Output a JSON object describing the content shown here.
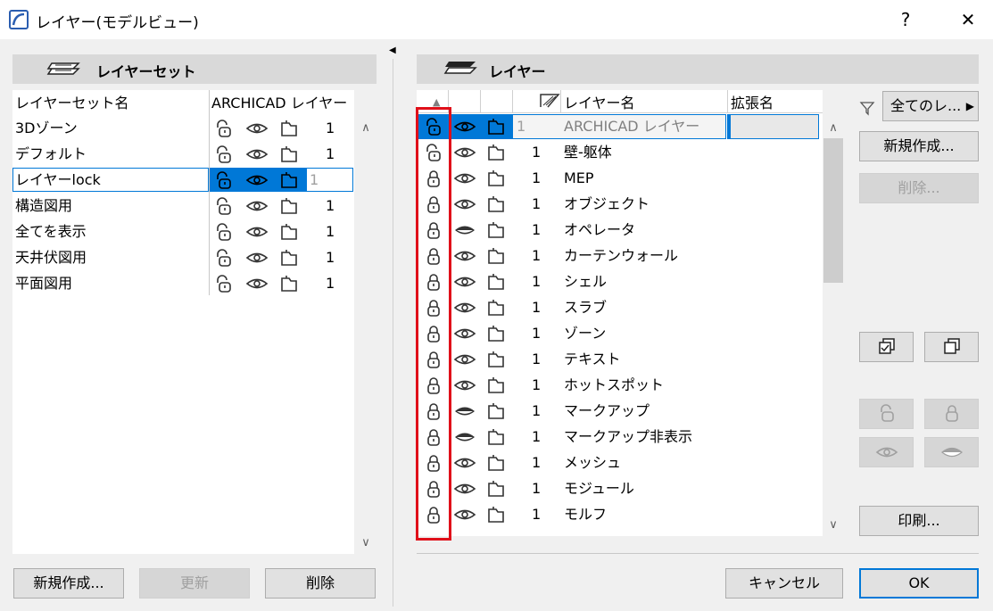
{
  "window": {
    "title": "レイヤー(モデルビュー)",
    "help": "?",
    "close": "✕"
  },
  "left": {
    "header": "レイヤーセット",
    "columns": {
      "name": "レイヤーセット名",
      "archicad": "ARCHICAD レイヤー"
    },
    "rows": [
      {
        "name": "3Dゾーン",
        "value": "1",
        "lock": "unlocked",
        "eye": "open"
      },
      {
        "name": "デフォルト",
        "value": "1",
        "lock": "unlocked",
        "eye": "open"
      },
      {
        "name": "レイヤーlock",
        "value": "1",
        "lock": "unlocked",
        "eye": "open",
        "selected": true
      },
      {
        "name": "構造図用",
        "value": "1",
        "lock": "unlocked",
        "eye": "open"
      },
      {
        "name": "全てを表示",
        "value": "1",
        "lock": "unlocked",
        "eye": "open"
      },
      {
        "name": "天井伏図用",
        "value": "1",
        "lock": "unlocked",
        "eye": "open"
      },
      {
        "name": "平面図用",
        "value": "1",
        "lock": "unlocked",
        "eye": "open"
      }
    ],
    "buttons": {
      "new": "新規作成...",
      "update": "更新",
      "delete": "削除"
    }
  },
  "right": {
    "header": "レイヤー",
    "columns": {
      "name": "レイヤー名",
      "ext": "拡張名"
    },
    "filter_label": "全てのレ...",
    "rows": [
      {
        "name": "ARCHICAD レイヤー",
        "value": "1",
        "lock": "unlocked",
        "eye": "open",
        "selected": true
      },
      {
        "name": "壁-躯体",
        "value": "1",
        "lock": "unlocked",
        "eye": "open"
      },
      {
        "name": "MEP",
        "value": "1",
        "lock": "locked",
        "eye": "open"
      },
      {
        "name": "オブジェクト",
        "value": "1",
        "lock": "locked",
        "eye": "open"
      },
      {
        "name": "オペレータ",
        "value": "1",
        "lock": "locked",
        "eye": "hidden"
      },
      {
        "name": "カーテンウォール",
        "value": "1",
        "lock": "locked",
        "eye": "open"
      },
      {
        "name": "シェル",
        "value": "1",
        "lock": "locked",
        "eye": "open"
      },
      {
        "name": "スラブ",
        "value": "1",
        "lock": "locked",
        "eye": "open"
      },
      {
        "name": "ゾーン",
        "value": "1",
        "lock": "locked",
        "eye": "open"
      },
      {
        "name": "テキスト",
        "value": "1",
        "lock": "locked",
        "eye": "open"
      },
      {
        "name": "ホットスポット",
        "value": "1",
        "lock": "locked",
        "eye": "open"
      },
      {
        "name": "マークアップ",
        "value": "1",
        "lock": "locked",
        "eye": "hidden"
      },
      {
        "name": "マークアップ非表示",
        "value": "1",
        "lock": "locked",
        "eye": "hidden"
      },
      {
        "name": "メッシュ",
        "value": "1",
        "lock": "locked",
        "eye": "open"
      },
      {
        "name": "モジュール",
        "value": "1",
        "lock": "locked",
        "eye": "open"
      },
      {
        "name": "モルフ",
        "value": "1",
        "lock": "locked",
        "eye": "open"
      }
    ],
    "buttons": {
      "new": "新規作成...",
      "delete": "削除...",
      "print": "印刷...",
      "cancel": "キャンセル",
      "ok": "OK"
    }
  },
  "colors": {
    "selection": "#0078d7",
    "highlight_box": "#e0101a"
  }
}
